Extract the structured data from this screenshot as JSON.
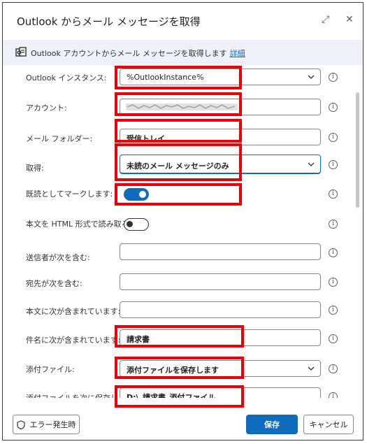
{
  "window": {
    "title": "Outlook からメール メッセージを取得",
    "expand_glyph": "⤢",
    "close_glyph": "✕"
  },
  "infobar": {
    "text": "Outlook アカウントからメール メッセージを取得します",
    "link": "詳細",
    "icon": "outlook-icon"
  },
  "fields": {
    "instance": {
      "label": "Outlook インスタンス:",
      "value": "%OutlookInstance%"
    },
    "account": {
      "label": "アカウント:",
      "value": ""
    },
    "folder": {
      "label": "メール フォルダー:",
      "value": "受信トレイ"
    },
    "retrieve": {
      "label": "取得:",
      "value": "未読のメール メッセージのみ"
    },
    "mark_read": {
      "label": "既読としてマークします:",
      "state": "on"
    },
    "html_body": {
      "label": "本文を HTML 形式で読み取る:",
      "state": "off"
    },
    "from": {
      "label": "送信者が次を含む:",
      "value": ""
    },
    "to": {
      "label": "宛先が次を含む:",
      "value": ""
    },
    "body_contains": {
      "label": "本文に次が含まれています:",
      "value": ""
    },
    "subject_contains": {
      "label": "件名に次が含まれています:",
      "value": "請求書"
    },
    "attachments": {
      "label": "添付ファイル:",
      "value": "添付ファイルを保存します"
    },
    "save_path": {
      "label": "添付ファイルを次に保存します:",
      "value": "D:\\_請求書_添付ファイル"
    }
  },
  "info_glyph": "i",
  "footer": {
    "error_button": "エラー発生時",
    "save_button": "保存",
    "cancel_button": "キャンセル"
  },
  "colors": {
    "accent": "#0f6cbd",
    "highlight_box": "#e8000b",
    "infobar_bg": "#eef1f8"
  }
}
